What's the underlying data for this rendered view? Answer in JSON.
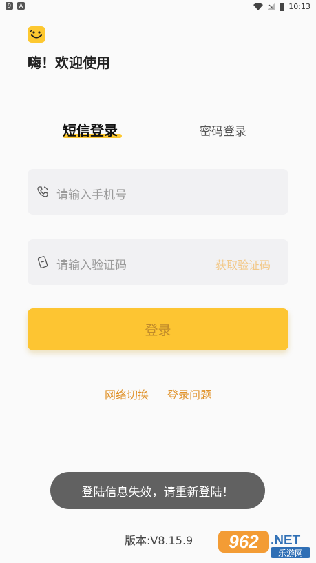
{
  "status_bar": {
    "left_icons": [
      "9",
      "A"
    ],
    "time": "10:13"
  },
  "header": {
    "greeting": "嗨！欢迎使用"
  },
  "tabs": {
    "sms_login": "短信登录",
    "password_login": "密码登录"
  },
  "form": {
    "phone_placeholder": "请输入手机号",
    "code_placeholder": "请输入验证码",
    "get_code_label": "获取验证码",
    "login_label": "登录"
  },
  "links": {
    "network_switch": "网络切换",
    "login_issue": "登录问题"
  },
  "toast": {
    "message": "登陆信息失效，请重新登陆！"
  },
  "footer": {
    "version": "版本:V8.15.9"
  },
  "watermark": {
    "brand_number": "962",
    "brand_suffix": ".NET",
    "brand_cn": "乐游网"
  },
  "colors": {
    "accent": "#fdc532",
    "link": "#e0922a",
    "get_code": "#f2c98a",
    "toast_bg": "#616161"
  }
}
